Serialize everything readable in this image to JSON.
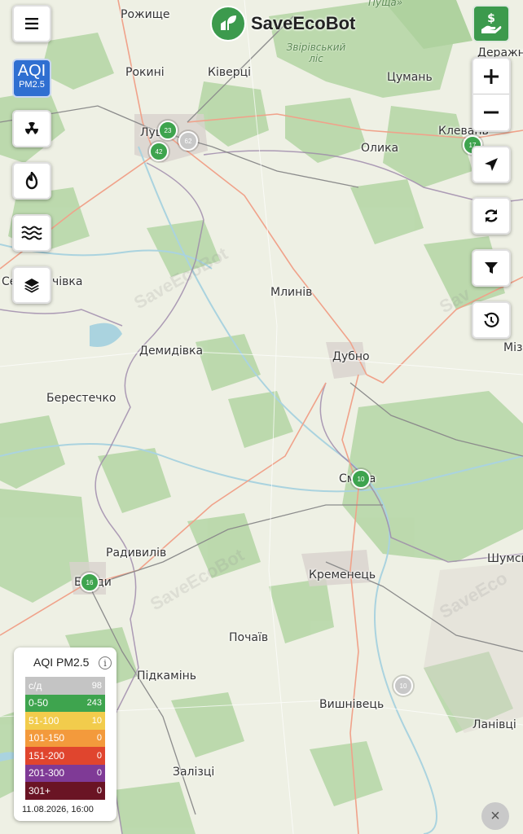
{
  "app": {
    "brand": "SaveEcoBot"
  },
  "map": {
    "places": [
      {
        "name": "Рожище",
        "cls": "p1"
      },
      {
        "name": "Рокині",
        "cls": "p2"
      },
      {
        "name": "Ківерці",
        "cls": "p3"
      },
      {
        "name": "Цумань",
        "cls": "p4"
      },
      {
        "name": "Дераж­не",
        "cls": "p5"
      },
      {
        "name": "Клевань",
        "cls": "p6"
      },
      {
        "name": "Олика",
        "cls": "p7"
      },
      {
        "name": "Луцьк",
        "cls": "p8"
      },
      {
        "name": "Сенкевичівка",
        "cls": "p9"
      },
      {
        "name": "Млинів",
        "cls": "p10"
      },
      {
        "name": "Демидівка",
        "cls": "p11"
      },
      {
        "name": "Дубно",
        "cls": "p12"
      },
      {
        "name": "Міз",
        "cls": "p13"
      },
      {
        "name": "Берестечко",
        "cls": "p14"
      },
      {
        "name": "Смига",
        "cls": "p15"
      },
      {
        "name": "Радивилів",
        "cls": "p16"
      },
      {
        "name": "Шумськ",
        "cls": "p17"
      },
      {
        "name": "Броди",
        "cls": "p18"
      },
      {
        "name": "Кременець",
        "cls": "p19"
      },
      {
        "name": "Почаїв",
        "cls": "p20"
      },
      {
        "name": "Підкамінь",
        "cls": "p21"
      },
      {
        "name": "Вишнівець",
        "cls": "p22"
      },
      {
        "name": "Ланівці",
        "cls": "p23"
      },
      {
        "name": "Залізці",
        "cls": "p24"
      }
    ],
    "forest_labels": [
      {
        "text": "Звірівський\nліс",
        "cls": "f1"
      },
      {
        "text": "Пуща»",
        "cls": "f2"
      }
    ],
    "watermark": "SaveEcoBot",
    "markers": [
      {
        "value": "23",
        "color": "green",
        "cls": "m1"
      },
      {
        "value": "42",
        "color": "green",
        "cls": "m2"
      },
      {
        "value": "62",
        "color": "grey",
        "cls": "m3"
      },
      {
        "value": "17",
        "color": "green",
        "cls": "m4"
      },
      {
        "value": "10",
        "color": "green",
        "cls": "m5"
      },
      {
        "value": "16",
        "color": "green",
        "cls": "m6"
      },
      {
        "value": "10",
        "color": "grey",
        "cls": "m7"
      }
    ]
  },
  "controls": {
    "menu_icon": "menu-icon",
    "aqi_button": {
      "line1": "AQI",
      "line2": "PM2.5"
    },
    "left_icons": [
      "radiation-icon",
      "fire-icon",
      "water-waves-icon",
      "layers-icon"
    ],
    "right_icons": [
      "zoom-in-icon",
      "zoom-out-icon",
      "locate-icon",
      "refresh-icon",
      "filter-icon",
      "history-icon"
    ],
    "donate_icon": "donate-hand-icon"
  },
  "legend": {
    "title": "AQI PM2.5",
    "info": "i",
    "rows": [
      {
        "range": "с/д",
        "count": "98",
        "color": "#c4c4c4",
        "text": "#ffffff"
      },
      {
        "range": "0-50",
        "count": "243",
        "color": "#3ea44e",
        "text": "#ffffff"
      },
      {
        "range": "51-100",
        "count": "10",
        "color": "#f2cc4c",
        "text": "#ffffff"
      },
      {
        "range": "101-150",
        "count": "0",
        "color": "#f39a3c",
        "text": "#ffffff"
      },
      {
        "range": "151-200",
        "count": "0",
        "color": "#e0452e",
        "text": "#ffffff"
      },
      {
        "range": "201-300",
        "count": "0",
        "color": "#7f3a96",
        "text": "#ffffff"
      },
      {
        "range": "301+",
        "count": "0",
        "color": "#6a1424",
        "text": "#ffffff"
      }
    ],
    "timestamp": "11.08.2026, 16:00"
  },
  "close_label": "×"
}
